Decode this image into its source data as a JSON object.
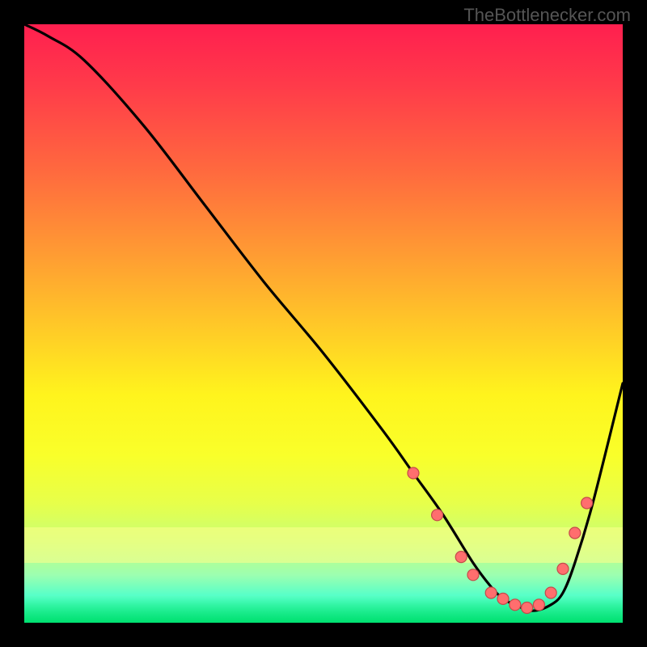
{
  "watermark": "TheBottlenecker.com",
  "chart_data": {
    "type": "line",
    "title": "",
    "xlabel": "",
    "ylabel": "",
    "xlim": [
      0,
      100
    ],
    "ylim": [
      0,
      100
    ],
    "x": [
      0,
      4,
      10,
      20,
      30,
      40,
      50,
      60,
      65,
      70,
      75,
      78,
      80,
      82,
      85,
      88,
      90,
      92,
      95,
      100
    ],
    "values": [
      100,
      98,
      94,
      83,
      70,
      57,
      45,
      32,
      25,
      18,
      10,
      6,
      4,
      3,
      2,
      3,
      5,
      10,
      20,
      40
    ],
    "markers": [
      {
        "x": 65,
        "y": 25
      },
      {
        "x": 69,
        "y": 18
      },
      {
        "x": 73,
        "y": 11
      },
      {
        "x": 75,
        "y": 8
      },
      {
        "x": 78,
        "y": 5
      },
      {
        "x": 80,
        "y": 4
      },
      {
        "x": 82,
        "y": 3
      },
      {
        "x": 84,
        "y": 2.5
      },
      {
        "x": 86,
        "y": 3
      },
      {
        "x": 88,
        "y": 5
      },
      {
        "x": 90,
        "y": 9
      },
      {
        "x": 92,
        "y": 15
      },
      {
        "x": 94,
        "y": 20
      }
    ],
    "background_gradient": {
      "top": "#ff1f4f",
      "mid": "#fff41d",
      "bottom": "#00ff88"
    }
  }
}
